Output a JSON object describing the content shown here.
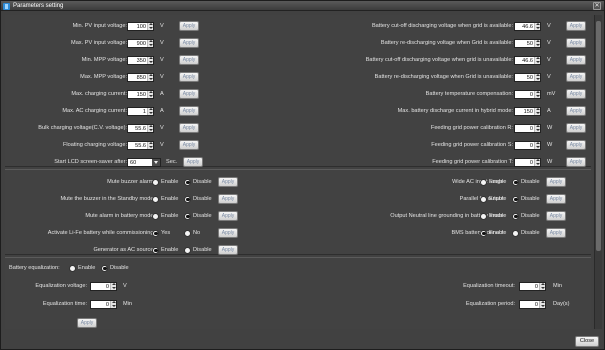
{
  "window": {
    "title": "Parameters setting",
    "close_button": "Close"
  },
  "apply_label": "Apply",
  "left_params": [
    {
      "label": "Min. PV input voltage:",
      "value": "100",
      "unit": "V"
    },
    {
      "label": "Max. PV input voltage:",
      "value": "900",
      "unit": "V"
    },
    {
      "label": "Min. MPP voltage:",
      "value": "350",
      "unit": "V"
    },
    {
      "label": "Max. MPP voltage:",
      "value": "850",
      "unit": "V"
    },
    {
      "label": "Max. charging current:",
      "value": "150",
      "unit": "A"
    },
    {
      "label": "Max. AC charging current:",
      "value": "1",
      "unit": "A"
    },
    {
      "label": "Bulk charging voltage(C.V. voltage):",
      "value": "55.6",
      "unit": "V"
    },
    {
      "label": "Floating charging voltage:",
      "value": "55.6",
      "unit": "V"
    }
  ],
  "screensaver": {
    "label": "Start LCD screen-saver after:",
    "value": "60",
    "unit": "Sec."
  },
  "right_params": [
    {
      "label": "Battery cut-off discharging voltage when grid is available:",
      "value": "46.6",
      "unit": "V"
    },
    {
      "label": "Battery re-discharging voltage when Grid is available:",
      "value": "50",
      "unit": "V"
    },
    {
      "label": "Battery cut-off discharging voltage when grid is unavailable:",
      "value": "46.6",
      "unit": "V"
    },
    {
      "label": "Battery re-discharging voltage when Grid is unavailable:",
      "value": "50",
      "unit": "V"
    },
    {
      "label": "Battery temperature compensation:",
      "value": "0",
      "unit": "mV"
    },
    {
      "label": "Max. battery discharge current in hybrid mode:",
      "value": "150",
      "unit": "A"
    },
    {
      "label": "Feeding grid power calibration R:",
      "value": "0",
      "unit": "W"
    },
    {
      "label": "Feeding grid power calibration S:",
      "value": "0",
      "unit": "W"
    },
    {
      "label": "Feeding grid power calibration T:",
      "value": "0",
      "unit": "W"
    }
  ],
  "radio_left": [
    {
      "label": "Mute buzzer alarm:",
      "opt1": "Enable",
      "opt2": "Disable",
      "selected": "opt2"
    },
    {
      "label": "Mute the buzzer in the Standby mode:",
      "opt1": "Enable",
      "opt2": "Disable",
      "selected": "opt2"
    },
    {
      "label": "Mute alarm in battery mode:",
      "opt1": "Enable",
      "opt2": "Disable",
      "selected": "opt2"
    },
    {
      "label": "Activate Li-Fe battery while commissioning:",
      "opt1": "Yes",
      "opt2": "No",
      "selected": "opt1"
    },
    {
      "label": "Generator as AC source:",
      "opt1": "Enable",
      "opt2": "Disable",
      "selected": "opt1"
    }
  ],
  "radio_right": [
    {
      "label": "Wide AC input range:",
      "opt1": "Enable",
      "opt2": "Disable",
      "selected": "opt2"
    },
    {
      "label": "Parallel for output:",
      "opt1": "Enable",
      "opt2": "Disable",
      "selected": "opt2"
    },
    {
      "label": "Output Neutral line grounding in battery mode:",
      "opt1": "Enable",
      "opt2": "Disable",
      "selected": "opt2"
    },
    {
      "label": "BMS battery connect:",
      "opt1": "Enable",
      "opt2": "Disable",
      "selected": "opt1"
    }
  ],
  "equalization": {
    "label": "Battery equalization:",
    "opt1": "Enable",
    "opt2": "Disable",
    "selected": "opt2",
    "voltage": {
      "label": "Equalization voltage:",
      "value": "0",
      "unit": "V"
    },
    "time": {
      "label": "Equalization time:",
      "value": "0",
      "unit": "Min"
    },
    "timeout": {
      "label": "Equalization timeout:",
      "value": "0",
      "unit": "Min"
    },
    "period": {
      "label": "Equalization period:",
      "value": "0",
      "unit": "Day(s)"
    }
  }
}
